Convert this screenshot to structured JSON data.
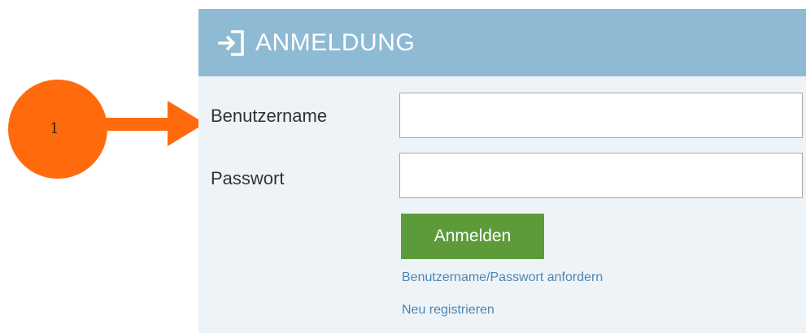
{
  "annotation": {
    "number": "1",
    "circle_color": "#ff6a0d",
    "arrow_color": "#ff6a0d"
  },
  "login": {
    "header_icon": "sign-in-icon",
    "title": "ANMELDUNG",
    "username_label": "Benutzername",
    "username_value": "",
    "password_label": "Passwort",
    "password_value": "",
    "submit_label": "Anmelden",
    "forgot_link": "Benutzername/Passwort anfordern",
    "register_link": "Neu registrieren"
  },
  "colors": {
    "header_bg": "#8fbad3",
    "panel_bg": "#eef3f8",
    "button_bg": "#5d9b3a",
    "link": "#4d86b3"
  }
}
